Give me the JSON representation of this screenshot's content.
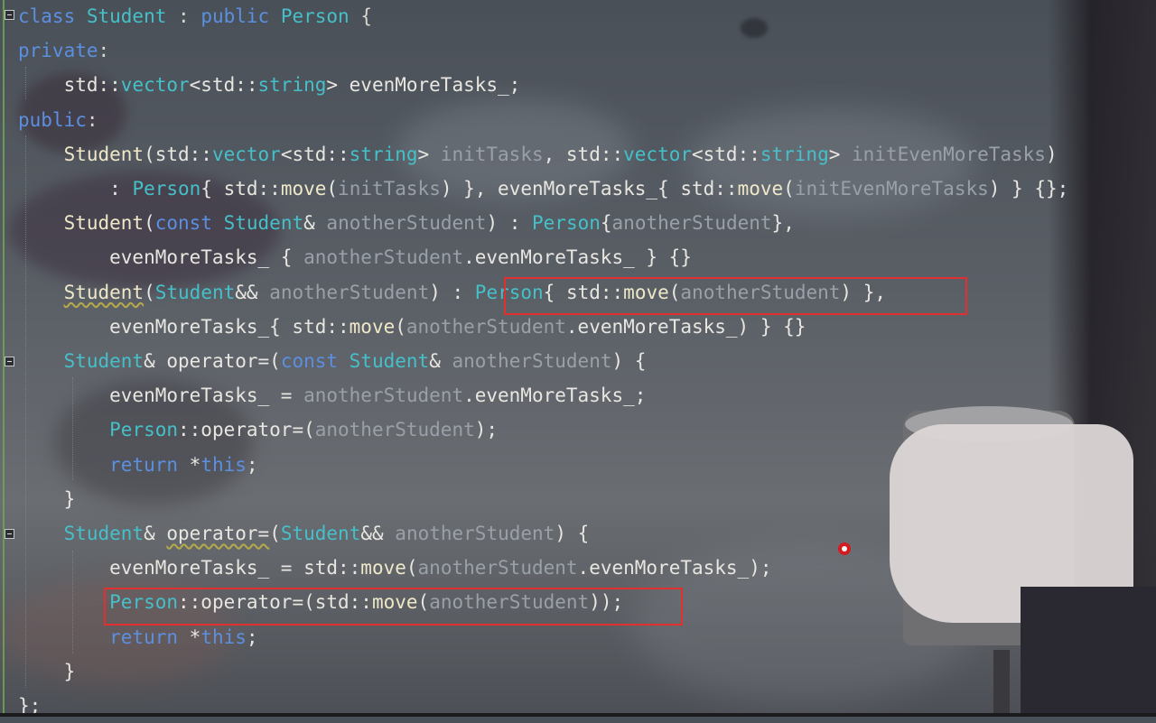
{
  "editor": {
    "language": "C++",
    "lines": [
      [
        {
          "t": "class ",
          "c": "kw"
        },
        {
          "t": "Student",
          "c": "ty"
        },
        {
          "t": " : ",
          "c": "p"
        },
        {
          "t": "public ",
          "c": "kw"
        },
        {
          "t": "Person",
          "c": "ty"
        },
        {
          "t": " {",
          "c": "p"
        }
      ],
      [
        {
          "t": "private",
          "c": "kw"
        },
        {
          "t": ":",
          "c": "p"
        }
      ],
      [
        {
          "t": "    std::",
          "c": "tx"
        },
        {
          "t": "vector",
          "c": "ty"
        },
        {
          "t": "<std::",
          "c": "tx"
        },
        {
          "t": "string",
          "c": "ty"
        },
        {
          "t": "> evenMoreTasks_;",
          "c": "tx"
        }
      ],
      [
        {
          "t": "public",
          "c": "kw"
        },
        {
          "t": ":",
          "c": "p"
        }
      ],
      [
        {
          "t": "    ",
          "c": "tx"
        },
        {
          "t": "Student",
          "c": "st"
        },
        {
          "t": "(std::",
          "c": "tx"
        },
        {
          "t": "vector",
          "c": "ty"
        },
        {
          "t": "<std::",
          "c": "tx"
        },
        {
          "t": "string",
          "c": "ty"
        },
        {
          "t": "> ",
          "c": "tx"
        },
        {
          "t": "initTasks",
          "c": "pm"
        },
        {
          "t": ", std::",
          "c": "tx"
        },
        {
          "t": "vector",
          "c": "ty"
        },
        {
          "t": "<std::",
          "c": "tx"
        },
        {
          "t": "string",
          "c": "ty"
        },
        {
          "t": "> ",
          "c": "tx"
        },
        {
          "t": "initEvenMoreTasks",
          "c": "pm"
        },
        {
          "t": ")",
          "c": "tx"
        }
      ],
      [
        {
          "t": "        : ",
          "c": "tx"
        },
        {
          "t": "Person",
          "c": "ty"
        },
        {
          "t": "{ std::",
          "c": "tx"
        },
        {
          "t": "move",
          "c": "st"
        },
        {
          "t": "(",
          "c": "tx"
        },
        {
          "t": "initTasks",
          "c": "pm"
        },
        {
          "t": ") }, evenMoreTasks_{ std::",
          "c": "tx"
        },
        {
          "t": "move",
          "c": "st"
        },
        {
          "t": "(",
          "c": "tx"
        },
        {
          "t": "initEvenMoreTasks",
          "c": "pm"
        },
        {
          "t": ") } {};",
          "c": "tx"
        }
      ],
      [
        {
          "t": "    ",
          "c": "tx"
        },
        {
          "t": "Student",
          "c": "st"
        },
        {
          "t": "(",
          "c": "tx"
        },
        {
          "t": "const ",
          "c": "kw"
        },
        {
          "t": "Student",
          "c": "ty"
        },
        {
          "t": "& ",
          "c": "tx"
        },
        {
          "t": "anotherStudent",
          "c": "pm"
        },
        {
          "t": ") : ",
          "c": "tx"
        },
        {
          "t": "Person",
          "c": "ty"
        },
        {
          "t": "{",
          "c": "tx"
        },
        {
          "t": "anotherStudent",
          "c": "pm"
        },
        {
          "t": "},",
          "c": "tx"
        }
      ],
      [
        {
          "t": "        evenMoreTasks_ { ",
          "c": "tx"
        },
        {
          "t": "anotherStudent",
          "c": "pm"
        },
        {
          "t": ".evenMoreTasks_ } {}",
          "c": "tx"
        }
      ],
      [
        {
          "t": "    ",
          "c": "tx"
        },
        {
          "t": "Student",
          "c": "st sq"
        },
        {
          "t": "(",
          "c": "tx"
        },
        {
          "t": "Student",
          "c": "ty"
        },
        {
          "t": "&& ",
          "c": "tx"
        },
        {
          "t": "anotherStudent",
          "c": "pm"
        },
        {
          "t": ") : ",
          "c": "tx"
        },
        {
          "t": "Person",
          "c": "ty"
        },
        {
          "t": "{ std::",
          "c": "tx"
        },
        {
          "t": "move",
          "c": "st"
        },
        {
          "t": "(",
          "c": "tx"
        },
        {
          "t": "anotherStudent",
          "c": "pm"
        },
        {
          "t": ") },",
          "c": "tx"
        }
      ],
      [
        {
          "t": "        evenMoreTasks_{ std::",
          "c": "tx"
        },
        {
          "t": "move",
          "c": "st"
        },
        {
          "t": "(",
          "c": "tx"
        },
        {
          "t": "anotherStudent",
          "c": "pm"
        },
        {
          "t": ".evenMoreTasks_) } {}",
          "c": "tx"
        }
      ],
      [
        {
          "t": "    ",
          "c": "tx"
        },
        {
          "t": "Student",
          "c": "ty"
        },
        {
          "t": "& operator=(",
          "c": "tx"
        },
        {
          "t": "const ",
          "c": "kw"
        },
        {
          "t": "Student",
          "c": "ty"
        },
        {
          "t": "& ",
          "c": "tx"
        },
        {
          "t": "anotherStudent",
          "c": "pm"
        },
        {
          "t": ") {",
          "c": "tx"
        }
      ],
      [
        {
          "t": "        evenMoreTasks_ = ",
          "c": "tx"
        },
        {
          "t": "anotherStudent",
          "c": "pm"
        },
        {
          "t": ".evenMoreTasks_;",
          "c": "tx"
        }
      ],
      [
        {
          "t": "        ",
          "c": "tx"
        },
        {
          "t": "Person",
          "c": "ty"
        },
        {
          "t": "::operator=(",
          "c": "tx"
        },
        {
          "t": "anotherStudent",
          "c": "pm"
        },
        {
          "t": ");",
          "c": "tx"
        }
      ],
      [
        {
          "t": "        ",
          "c": "tx"
        },
        {
          "t": "return ",
          "c": "kw"
        },
        {
          "t": "*",
          "c": "tx"
        },
        {
          "t": "this",
          "c": "kw"
        },
        {
          "t": ";",
          "c": "tx"
        }
      ],
      [
        {
          "t": "    }",
          "c": "tx"
        }
      ],
      [
        {
          "t": "    ",
          "c": "tx"
        },
        {
          "t": "Student",
          "c": "ty"
        },
        {
          "t": "& ",
          "c": "tx"
        },
        {
          "t": "operator=",
          "c": "tx sq"
        },
        {
          "t": "(",
          "c": "tx"
        },
        {
          "t": "Student",
          "c": "ty"
        },
        {
          "t": "&& ",
          "c": "tx"
        },
        {
          "t": "anotherStudent",
          "c": "pm"
        },
        {
          "t": ") {",
          "c": "tx"
        }
      ],
      [
        {
          "t": "        evenMoreTasks_ = std::",
          "c": "tx"
        },
        {
          "t": "move",
          "c": "st"
        },
        {
          "t": "(",
          "c": "tx"
        },
        {
          "t": "anotherStudent",
          "c": "pm"
        },
        {
          "t": ".evenMoreTasks_);",
          "c": "tx"
        }
      ],
      [
        {
          "t": "        ",
          "c": "tx"
        },
        {
          "t": "Person",
          "c": "ty"
        },
        {
          "t": "::operator=(std::",
          "c": "tx"
        },
        {
          "t": "move",
          "c": "st"
        },
        {
          "t": "(",
          "c": "tx"
        },
        {
          "t": "anotherStudent",
          "c": "pm"
        },
        {
          "t": "));",
          "c": "tx"
        }
      ],
      [
        {
          "t": "        ",
          "c": "tx"
        },
        {
          "t": "return ",
          "c": "kw"
        },
        {
          "t": "*",
          "c": "tx"
        },
        {
          "t": "this",
          "c": "kw"
        },
        {
          "t": ";",
          "c": "tx"
        }
      ],
      [
        {
          "t": "    }",
          "c": "tx"
        }
      ],
      [
        {
          "t": "};",
          "c": "tx"
        }
      ]
    ],
    "highlights": [
      {
        "line": 9,
        "text": "Person{ std::move(anotherStudent) },"
      },
      {
        "line": 18,
        "text": "Person::operator=(std::move(anotherStudent));"
      }
    ]
  },
  "colors": {
    "keyword": "#5b8fe0",
    "type": "#45c0c9",
    "function": "#efe8c8",
    "parameter": "#9aa0a8",
    "text": "#e8e6e0",
    "highlight_box": "#e0302f",
    "cursor": "#d41c20"
  },
  "icons": [
    "fold-toggle-icon",
    "mouse-cursor-indicator-icon"
  ]
}
